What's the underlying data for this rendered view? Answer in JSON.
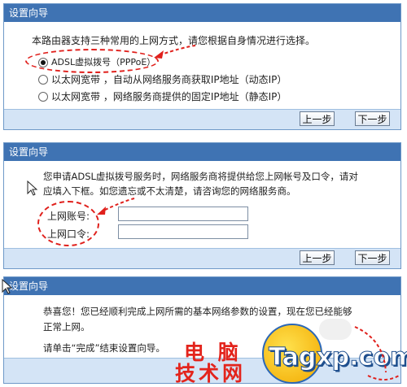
{
  "panel1": {
    "title": "设置向导",
    "intro": "本路由器支持三种常用的上网方式，请您根据自身情况进行选择。",
    "options": [
      {
        "label": "ADSL虚拟拨号（PPPoE）",
        "selected": true
      },
      {
        "label": "以太网宽带 ，自动从网络服务商获取IP地址（动态IP）",
        "selected": false
      },
      {
        "label": "以太网宽带 ，网络服务商提供的固定IP地址（静态IP）",
        "selected": false
      }
    ],
    "prev_label": "上一步",
    "next_label": "下一步"
  },
  "panel2": {
    "title": "设置向导",
    "desc_line1": "您申请ADSL虚拟拨号服务时，网络服务商将提供给您上网帐号及口令，请对",
    "desc_line2": "应填入下框。如您遗忘或不太清楚，请咨询您的网络服务商。",
    "account_label": "上网账号:",
    "account_value": "",
    "password_label": "上网口令:",
    "password_value": "",
    "prev_label": "上一步",
    "next_label": "下一步"
  },
  "panel3": {
    "title": "设置向导",
    "line1": "恭喜您！您已经顺利完成上网所需的基本网络参数的设置，现在您已经能够",
    "line2": "正常上网。",
    "line3": "请单击“完成”结束设置向导。"
  },
  "watermark": {
    "cn_line1": "电 脑",
    "cn_line2": "技术网",
    "site": "Tagxp.com"
  },
  "colors": {
    "header": "#3f73b3",
    "footer": "#d4e4f6",
    "annotation": "#e0201c"
  }
}
